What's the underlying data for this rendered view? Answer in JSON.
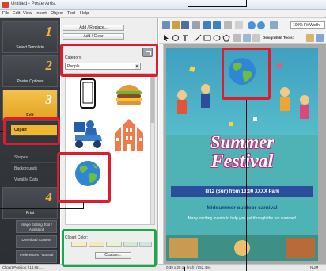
{
  "app": {
    "title": "Untitled - PosterArtist"
  },
  "menu": [
    "File",
    "Edit",
    "View",
    "Insert",
    "Object",
    "Tool",
    "Help"
  ],
  "sidebar": {
    "steps": [
      {
        "num": "1",
        "label": "Select Template"
      },
      {
        "num": "2",
        "label": "Poster Options"
      },
      {
        "num": "3",
        "label": "Edit"
      },
      {
        "num": "4",
        "label": "Print"
      }
    ],
    "items": [
      {
        "label": "Clipart"
      },
      {
        "label": "Shapes"
      },
      {
        "label": "Backgrounds"
      },
      {
        "label": "Variable Data"
      }
    ],
    "actions": [
      {
        "label": "Image Editing Tool / Assistant"
      },
      {
        "label": "Download Content"
      },
      {
        "label": "Preferences / Manual"
      }
    ]
  },
  "panel": {
    "add_button_1": "Add / Replace...",
    "add_button_2": "Add / Clear",
    "category_label": "Category:",
    "category_value": "People",
    "cliparts": [
      {
        "name": "smartphone"
      },
      {
        "name": "hamburger"
      },
      {
        "name": "delivery-scooter"
      },
      {
        "name": "building"
      },
      {
        "name": "earth-globe"
      }
    ],
    "clipart_color_label": "Clipart Color:",
    "custom_button": "Custom...",
    "swatch_colors": [
      "#f5efc2",
      "#f6e9b5",
      "#e9f2d0",
      "#d3e8d5",
      "#cfe4e0"
    ]
  },
  "toolbar": {
    "zoom_value": "100% Fit Width",
    "design_edit_label": "Design Edit Tools:"
  },
  "poster": {
    "title_line1": "Summer",
    "title_line2": "Festival",
    "date_line": "8/12 (Sun) from 13:00 XXXX Park",
    "subtitle": "Midsummer outdoor carnival",
    "description": "Many exciting events to help you get through the hot summer!"
  },
  "status": {
    "left": "Clipart Position: (14.98, ...)",
    "center": "0.39 x 25.11 (inch) (152.4%)",
    "right": "NUM"
  },
  "colors": {
    "highlight_red": "#e01b2d",
    "highlight_green": "#1aa94a",
    "step_active": "#f0b730",
    "poster_bg": "#4fb2b5"
  }
}
